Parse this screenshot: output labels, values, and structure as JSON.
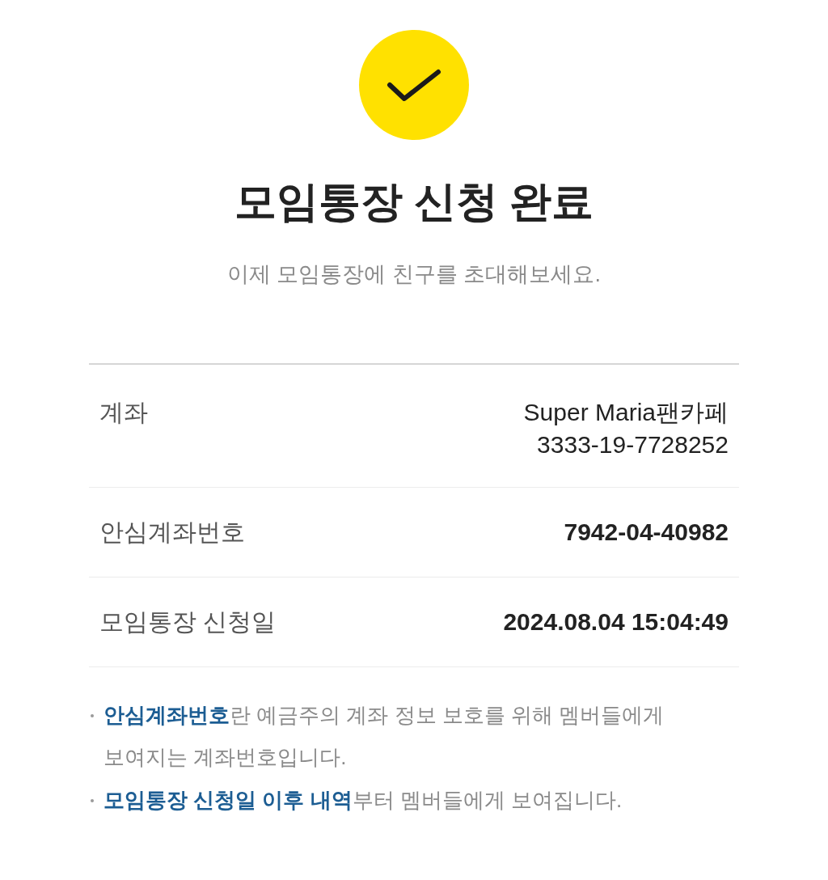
{
  "status": {
    "kind": "success"
  },
  "title": "모임통장 신청 완료",
  "subtitle": "이제 모임통장에 친구를 초대해보세요.",
  "details": [
    {
      "label": "계좌",
      "values": [
        "Super Maria팬카페",
        "3333-19-7728252"
      ],
      "bold": false
    },
    {
      "label": "안심계좌번호",
      "values": [
        "7942-04-40982"
      ],
      "bold": true
    },
    {
      "label": "모임통장 신청일",
      "values": [
        "2024.08.04 15:04:49"
      ],
      "bold": true
    }
  ],
  "notes": [
    "**안심계좌번호**란 예금주의 계좌 정보 보호를 위해 멤버들에게 보여지는 계좌번호입니다.",
    "**모임통장 신청일 이후 내역**부터 멤버들에게 보여집니다."
  ]
}
